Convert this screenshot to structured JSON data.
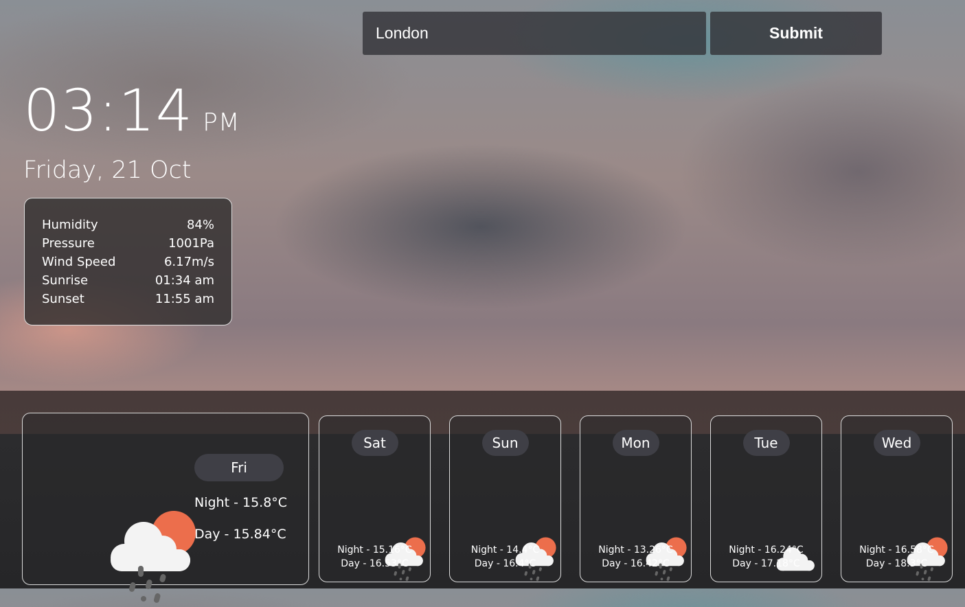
{
  "search": {
    "value": "London",
    "submit_label": "Submit"
  },
  "clock": {
    "time": "03:14",
    "ampm": "PM",
    "date": "Friday, 21 Oct"
  },
  "stats": [
    {
      "label": "Humidity",
      "value": "84%"
    },
    {
      "label": "Pressure",
      "value": "1001Pa"
    },
    {
      "label": "Wind Speed",
      "value": "6.17m/s"
    },
    {
      "label": "Sunrise",
      "value": "01:34 am"
    },
    {
      "label": "Sunset",
      "value": "11:55 am"
    }
  ],
  "today": {
    "day": "Fri",
    "night": "Night - 15.8°C",
    "dayTemp": "Day - 15.84°C",
    "icon": "cloud-sun-rain-icon"
  },
  "forecast": [
    {
      "day": "Sat",
      "night": "Night - 15.16°C",
      "dayTemp": "Day - 16.53°C",
      "icon": "cloud-sun-rain-icon"
    },
    {
      "day": "Sun",
      "night": "Night - 14.4°C",
      "dayTemp": "Day - 16.4°C",
      "icon": "cloud-sun-rain-icon"
    },
    {
      "day": "Mon",
      "night": "Night - 13.26°C",
      "dayTemp": "Day - 16.42°C",
      "icon": "cloud-sun-rain-icon"
    },
    {
      "day": "Tue",
      "night": "Night - 16.24°C",
      "dayTemp": "Day - 17.18°C",
      "icon": "cloud-icon"
    },
    {
      "day": "Wed",
      "night": "Night - 16.58°C",
      "dayTemp": "Day - 18.3°C",
      "icon": "cloud-sun-rain-icon"
    }
  ],
  "colors": {
    "sun": "#ec6e4c",
    "cloud": "#f3f3f3",
    "rain": "#666666"
  }
}
